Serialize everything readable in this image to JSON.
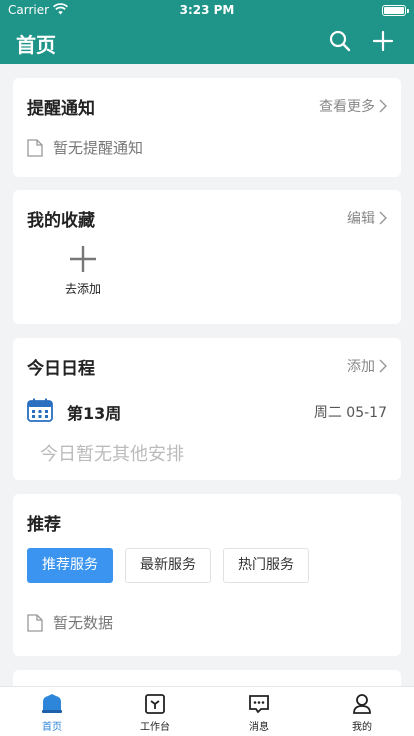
{
  "status_bar": {
    "carrier": "Carrier",
    "time": "3:23 PM"
  },
  "nav": {
    "title": "首页",
    "icons": [
      "search-icon",
      "plus-icon"
    ]
  },
  "reminders": {
    "title": "提醒通知",
    "action": "查看更多",
    "empty_text": "暂无提醒通知"
  },
  "favorites": {
    "title": "我的收藏",
    "action": "编辑",
    "add_label": "去添加"
  },
  "schedule": {
    "title": "今日日程",
    "action": "添加",
    "week": "第13周",
    "date": "周二 05-17",
    "empty_text": "今日暂无其他安排"
  },
  "recommend": {
    "title": "推荐",
    "tabs": [
      {
        "label": "推荐服务",
        "active": true
      },
      {
        "label": "最新服务",
        "active": false
      },
      {
        "label": "热门服务",
        "active": false
      }
    ],
    "empty_text": "暂无数据"
  },
  "tabbar": {
    "items": [
      {
        "label": "首页",
        "active": true
      },
      {
        "label": "工作台",
        "active": false
      },
      {
        "label": "消息",
        "active": false
      },
      {
        "label": "我的",
        "active": false
      }
    ]
  },
  "colors": {
    "header": "#1f9488",
    "accent": "#3b95f0",
    "tab_active": "#2d86d9"
  }
}
